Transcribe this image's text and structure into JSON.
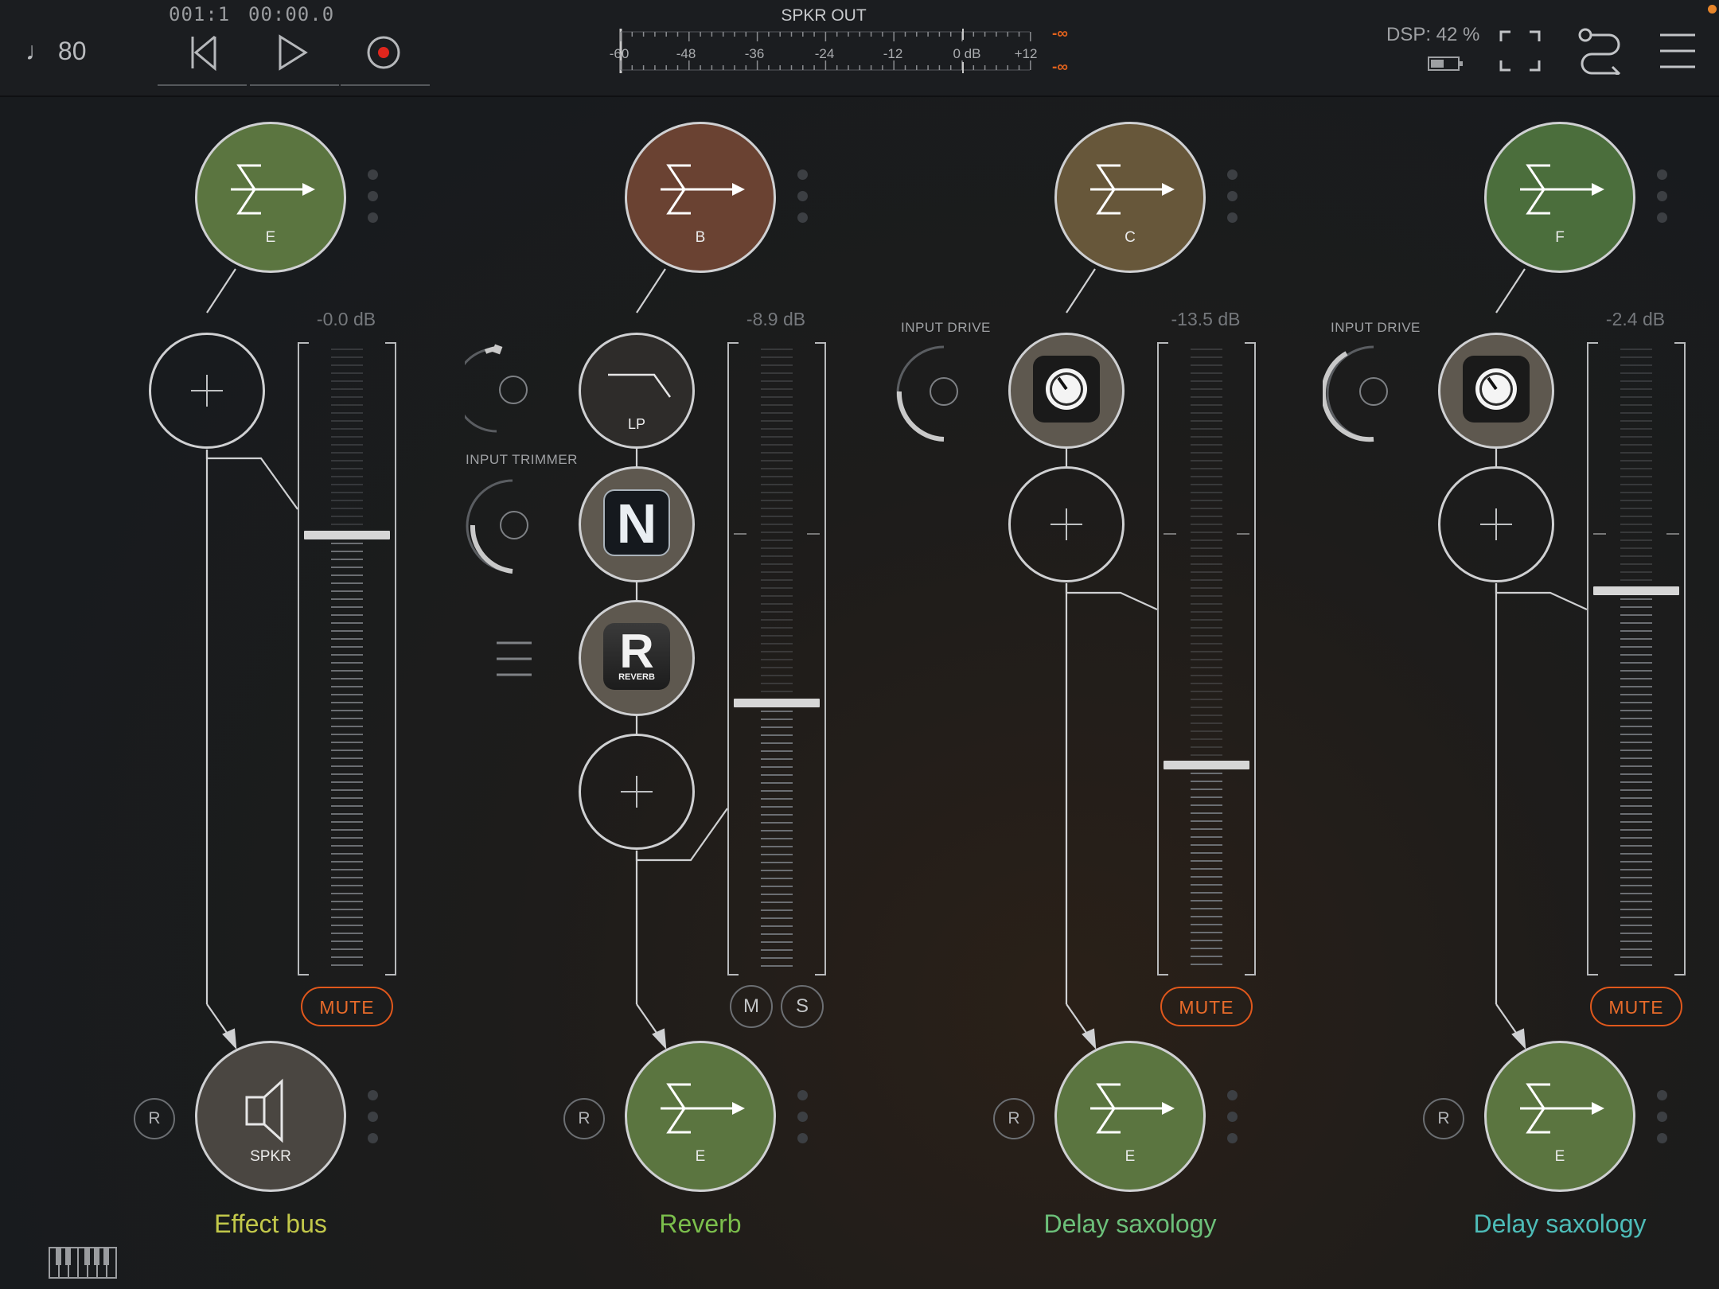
{
  "topbar": {
    "tempo": "♩ 80",
    "position": "001:1",
    "time": "00:00.0",
    "meter_title": "SPKR OUT",
    "meter_ticks": [
      "-60",
      "-48",
      "-36",
      "-24",
      "-12",
      "0 dB",
      "+12"
    ],
    "peak_left": "-∞",
    "peak_right": "-∞",
    "dsp": "DSP: 42 %"
  },
  "channels": [
    {
      "source": "E",
      "source_color": "#5b7540",
      "db": "-0.0 dB",
      "fader_level": 0.3,
      "dest": "SPKR",
      "dest_color": "#4a4641",
      "name": "Effect bus",
      "name_color": "#c2c84a",
      "mute": "MUTE",
      "r": "R"
    },
    {
      "source": "B",
      "source_color": "#6a4232",
      "db": "-8.9 dB",
      "fader_level": 0.57,
      "dest": "E",
      "dest_color": "#5b7540",
      "name": "Reverb",
      "name_color": "#7bbf4c",
      "m": "M",
      "s": "S",
      "r": "R",
      "plugins": [
        {
          "label": "LP"
        },
        {
          "label": "N"
        },
        {
          "label": "R",
          "sub": "REVERB"
        }
      ],
      "knob_label": "INPUT TRIMMER"
    },
    {
      "source": "C",
      "source_color": "#67573a",
      "db": "-13.5 dB",
      "fader_level": 0.67,
      "dest": "E",
      "dest_color": "#5b7540",
      "name": "Delay saxology",
      "name_color": "#6cc07a",
      "mute": "MUTE",
      "r": "R",
      "knob_label": "INPUT DRIVE"
    },
    {
      "source": "F",
      "source_color": "#4b6e3c",
      "db": "-2.4 dB",
      "fader_level": 0.39,
      "dest": "E",
      "dest_color": "#5b7540",
      "name": "Delay saxology",
      "name_color": "#4dbcb8",
      "mute": "MUTE",
      "r": "R",
      "knob_label": "INPUT DRIVE"
    }
  ]
}
